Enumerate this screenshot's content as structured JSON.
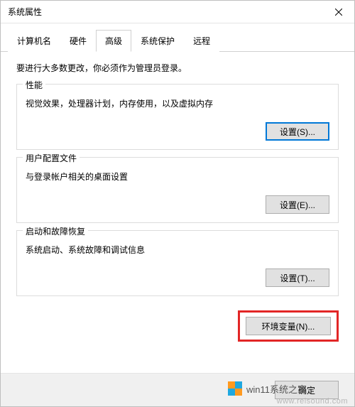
{
  "window": {
    "title": "系统属性"
  },
  "tabs": {
    "items": [
      {
        "label": "计算机名"
      },
      {
        "label": "硬件"
      },
      {
        "label": "高级"
      },
      {
        "label": "系统保护"
      },
      {
        "label": "远程"
      }
    ],
    "active_index": 2
  },
  "content": {
    "intro": "要进行大多数更改，你必须作为管理员登录。",
    "group_performance": {
      "legend": "性能",
      "desc": "视觉效果，处理器计划，内存使用，以及虚拟内存",
      "settings_label": "设置(S)..."
    },
    "group_profiles": {
      "legend": "用户配置文件",
      "desc": "与登录帐户相关的桌面设置",
      "settings_label": "设置(E)..."
    },
    "group_startup": {
      "legend": "启动和故障恢复",
      "desc": "系统启动、系统故障和调试信息",
      "settings_label": "设置(T)..."
    },
    "env_button": "环境变量(N)..."
  },
  "bottom": {
    "ok": "确定"
  },
  "watermarks": {
    "site1": "win11系统之家",
    "site2": "www.relsound.com"
  }
}
